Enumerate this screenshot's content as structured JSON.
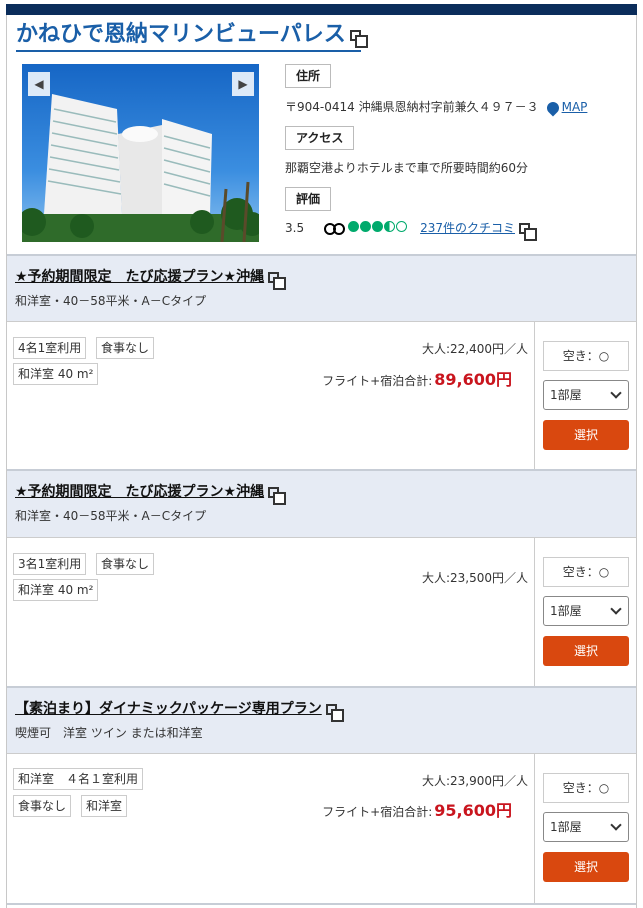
{
  "hotel": {
    "name": "かねひで恩納マリンビューパレス",
    "address_label": "住所",
    "address": "〒904-0414 沖縄県恩納村字前兼久４９７－３",
    "map_label": "MAP",
    "access_label": "アクセス",
    "access": "那覇空港よりホテルまで車で所要時間約60分",
    "rating_label": "評価",
    "rating": "3.5",
    "reviews_link": "237件のクチコミ"
  },
  "colors": {
    "link": "#1a5fa8",
    "accent_button": "#d9480f",
    "price_red": "#c9151e",
    "header_bg": "#e6ebf4",
    "rating_green": "#00aa6c"
  },
  "plans": [
    {
      "title": "★予約期間限定　たび応援プラン★沖縄",
      "subtitle": "和洋室・40－58平米・A－Cタイプ",
      "chips": [
        "4名1室利用",
        "食事なし",
        "和洋室 40 m²"
      ],
      "adult_price": "大人:22,400円／人",
      "total_label": "フライト+宿泊合計:",
      "total_price": "89,600円",
      "availability": "空き：○",
      "rooms_select": "1部屋",
      "select_button": "選択"
    },
    {
      "title": "★予約期間限定　たび応援プラン★沖縄",
      "subtitle": "和洋室・40－58平米・A－Cタイプ",
      "chips": [
        "3名1室利用",
        "食事なし",
        "和洋室 40 m²"
      ],
      "adult_price": "大人:23,500円／人",
      "availability": "空き：○",
      "rooms_select": "1部屋",
      "select_button": "選択"
    },
    {
      "title": "【素泊まり】ダイナミックパッケージ専用プラン",
      "subtitle": "喫煙可　洋室 ツイン または和洋室",
      "chips": [
        "和洋室　４名１室利用",
        "食事なし",
        "和洋室"
      ],
      "adult_price": "大人:23,900円／人",
      "total_label": "フライト+宿泊合計:",
      "total_price": "95,600円",
      "availability": "空き：○",
      "rooms_select": "1部屋",
      "select_button": "選択"
    }
  ]
}
